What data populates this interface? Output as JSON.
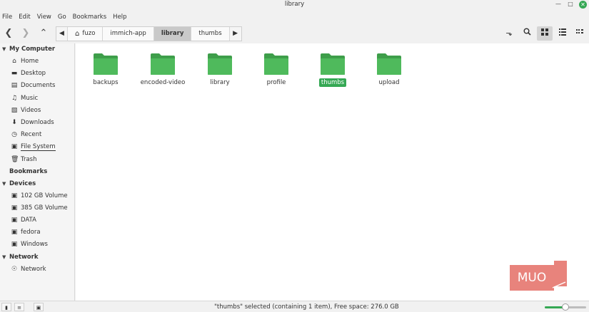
{
  "window": {
    "title": "library"
  },
  "menu": [
    "File",
    "Edit",
    "View",
    "Go",
    "Bookmarks",
    "Help"
  ],
  "breadcrumbs": [
    {
      "label": "fuzo",
      "icon": "home-icon"
    },
    {
      "label": "immich-app"
    },
    {
      "label": "library",
      "active": true
    },
    {
      "label": "thumbs"
    }
  ],
  "sidebar": {
    "my_computer": {
      "title": "My Computer",
      "items": [
        {
          "label": "Home",
          "icon": "home-icon"
        },
        {
          "label": "Desktop",
          "icon": "desktop-icon"
        },
        {
          "label": "Documents",
          "icon": "documents-icon"
        },
        {
          "label": "Music",
          "icon": "music-icon"
        },
        {
          "label": "Videos",
          "icon": "videos-icon"
        },
        {
          "label": "Downloads",
          "icon": "download-icon"
        },
        {
          "label": "Recent",
          "icon": "recent-icon"
        },
        {
          "label": "File System",
          "icon": "drive-icon"
        },
        {
          "label": "Trash",
          "icon": "trash-icon"
        }
      ]
    },
    "bookmarks": {
      "title": "Bookmarks"
    },
    "devices": {
      "title": "Devices",
      "items": [
        {
          "label": "102 GB Volume",
          "icon": "drive-icon"
        },
        {
          "label": "385 GB Volume",
          "icon": "drive-icon"
        },
        {
          "label": "DATA",
          "icon": "drive-icon"
        },
        {
          "label": "fedora",
          "icon": "drive-icon"
        },
        {
          "label": "Windows",
          "icon": "drive-icon"
        }
      ]
    },
    "network": {
      "title": "Network",
      "items": [
        {
          "label": "Network",
          "icon": "network-icon"
        }
      ]
    }
  },
  "folders": [
    {
      "name": "backups"
    },
    {
      "name": "encoded-video"
    },
    {
      "name": "library"
    },
    {
      "name": "profile"
    },
    {
      "name": "thumbs",
      "selected": true
    },
    {
      "name": "upload"
    }
  ],
  "status": {
    "text": "\"thumbs\" selected (containing 1 item), Free space: 276.0 GB"
  },
  "zoom": {
    "level": 0.5
  },
  "watermark": {
    "text": "MUO"
  },
  "colors": {
    "accent": "#35a854",
    "folder": "#4caf50",
    "watermark": "#e8837c"
  }
}
